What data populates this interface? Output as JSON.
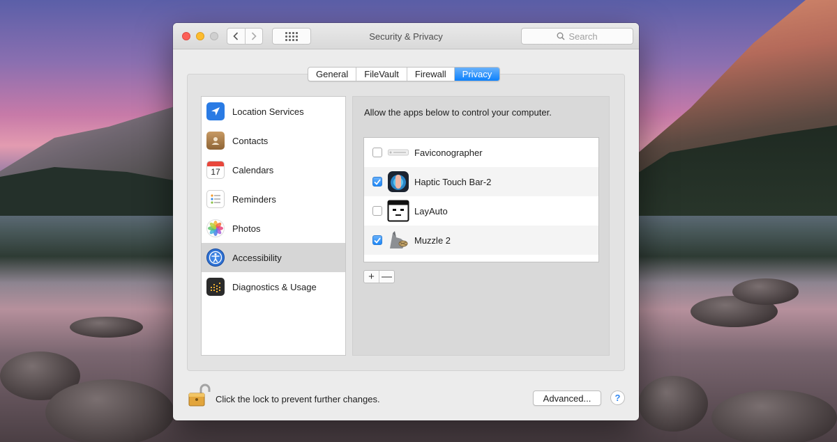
{
  "window": {
    "title": "Security & Privacy",
    "search_placeholder": "Search"
  },
  "tabs": [
    {
      "label": "General",
      "active": false
    },
    {
      "label": "FileVault",
      "active": false
    },
    {
      "label": "Firewall",
      "active": false
    },
    {
      "label": "Privacy",
      "active": true
    }
  ],
  "sidebar": {
    "selected": "Accessibility",
    "items": [
      {
        "label": "Location Services",
        "icon": "location-arrow-icon"
      },
      {
        "label": "Contacts",
        "icon": "contacts-book-icon"
      },
      {
        "label": "Calendars",
        "icon": "calendar-icon"
      },
      {
        "label": "Reminders",
        "icon": "reminders-list-icon"
      },
      {
        "label": "Photos",
        "icon": "photos-flower-icon"
      },
      {
        "label": "Accessibility",
        "icon": "accessibility-person-icon"
      },
      {
        "label": "Diagnostics & Usage",
        "icon": "diagnostics-grid-icon"
      }
    ]
  },
  "content": {
    "description": "Allow the apps below to control your computer.",
    "apps": [
      {
        "name": "Faviconographer",
        "checked": false,
        "icon": "faviconographer-icon"
      },
      {
        "name": "Haptic Touch Bar-2",
        "checked": true,
        "icon": "haptic-touch-bar-icon"
      },
      {
        "name": "LayAuto",
        "checked": false,
        "icon": "layauto-icon"
      },
      {
        "name": "Muzzle 2",
        "checked": true,
        "icon": "muzzle-icon"
      }
    ],
    "add_label": "+",
    "remove_label": "—"
  },
  "footer": {
    "lock_text": "Click the lock to prevent further changes.",
    "advanced_label": "Advanced...",
    "help_label": "?"
  },
  "colors": {
    "accent": "#0d81fc",
    "selection": "#d6d6d6"
  }
}
